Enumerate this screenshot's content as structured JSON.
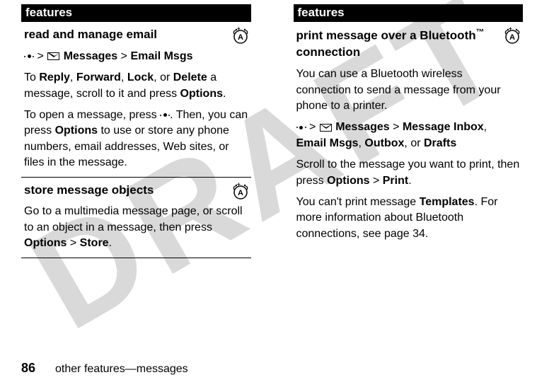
{
  "watermark": "DRAFT",
  "left": {
    "header": "features",
    "cells": [
      {
        "title": "read and manage email",
        "nav_parts": {
          "a": "Messages",
          "b": "Email Msgs"
        },
        "p1_pre": "To ",
        "p1_reply": "Reply",
        "p1_s1": ", ",
        "p1_forward": "Forward",
        "p1_s2": ", ",
        "p1_lock": "Lock",
        "p1_s3": ", or ",
        "p1_delete": "Delete",
        "p1_post": " a message, scroll to it and press ",
        "p1_options": "Options",
        "p1_end": ".",
        "p2_pre": "To open a message, press ",
        "p2_mid": ". Then, you can press ",
        "p2_options": "Options",
        "p2_post": " to use or store any phone numbers, email addresses, Web sites, or files in the message."
      },
      {
        "title": "store message objects",
        "p1_pre": "Go to a multimedia message page, or scroll to an object in a message, then press ",
        "p1_options": "Options",
        "p1_gt": " > ",
        "p1_store": "Store",
        "p1_end": "."
      }
    ]
  },
  "right": {
    "header": "features",
    "cells": [
      {
        "title_a": "print message over a Bluetooth",
        "title_tm": "™",
        "title_b": " connection",
        "p1": "You can use a Bluetooth wireless connection to send a message from your phone to a printer.",
        "nav_a": "Messages",
        "nav_b": "Message Inbox",
        "nav_c": "Email Msgs",
        "nav_d": "Outbox",
        "nav_e": "Drafts",
        "nav_or": ", or ",
        "nav_comma": ", ",
        "p3_pre": "Scroll to the message you want to print, then press ",
        "p3_options": "Options",
        "p3_gt": " > ",
        "p3_print": "Print",
        "p3_end": ".",
        "p4_pre": "You can't print message ",
        "p4_templates": "Templates",
        "p4_post": ". For more information about Bluetooth connections, see page 34."
      }
    ]
  },
  "footer": {
    "page": "86",
    "text": "other features—messages"
  }
}
